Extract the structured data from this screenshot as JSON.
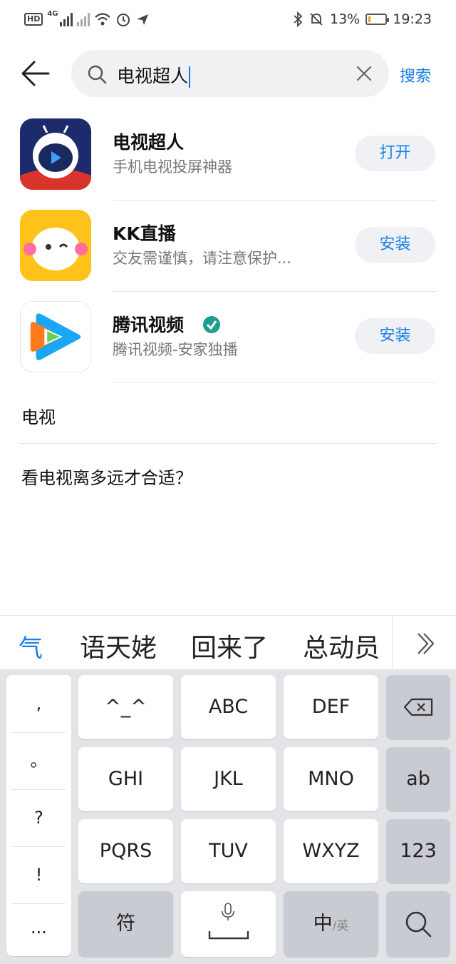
{
  "status_bar": {
    "signal_label": "4G",
    "battery_percent": "13%",
    "time": "19:23",
    "battery_level": 0.13
  },
  "search": {
    "query": "电视超人",
    "action_label": "搜索"
  },
  "results": [
    {
      "name": "电视超人",
      "description": "手机电视投屏神器",
      "button": "打开"
    },
    {
      "name": "KK直播",
      "description": "交友需谨慎，请注意保护...",
      "button": "安装"
    },
    {
      "name": "腾讯视频",
      "description": "腾讯视频-安家独播",
      "button": "安装"
    }
  ],
  "suggestions": [
    "电视",
    "看电视离多远才合适？"
  ],
  "keyboard": {
    "candidates": [
      "气",
      "语天姥",
      "回来了",
      "总动员"
    ],
    "punctuation": [
      ",",
      "。",
      "?",
      "!",
      "..."
    ],
    "rows": [
      [
        "^_^",
        "ABC",
        "DEF"
      ],
      [
        "GHI",
        "JKL",
        "MNO"
      ],
      [
        "PQRS",
        "TUV",
        "WXYZ"
      ]
    ],
    "side_keys": [
      "ab",
      "123"
    ],
    "symbol_key": "符",
    "lang_main": "中",
    "lang_alt": "/英"
  },
  "colors": {
    "accent": "#1a7ee6",
    "search_bg": "#f0f1f3",
    "button_bg": "#eff1f4",
    "keyboard_bg": "#e2e4e8"
  }
}
